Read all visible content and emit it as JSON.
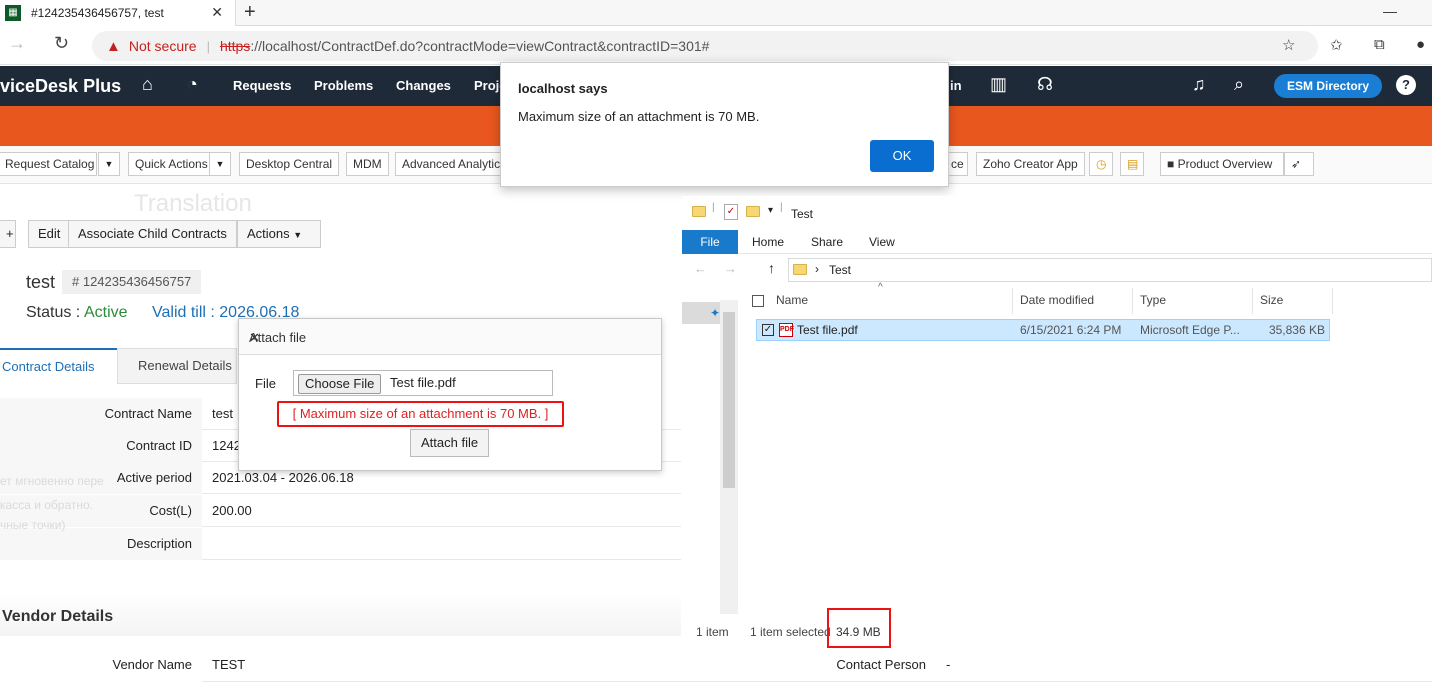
{
  "browser": {
    "tab_title": "#124235436456757, test",
    "tab_close": "✕",
    "new_tab": "+",
    "minimize": "—",
    "not_secure": "Not secure",
    "url_proto": "https",
    "url_rest": "://localhost/ContractDef.do?contractMode=viewContract&contractID=301#"
  },
  "app": {
    "logo": "viceDesk Plus",
    "nav": [
      "Requests",
      "Problems",
      "Changes",
      "Proje",
      "in"
    ],
    "esm": "ESM Directory",
    "help": "?"
  },
  "quickbar": {
    "items": [
      "Request Catalog",
      "Quick Actions",
      "Desktop Central",
      "MDM",
      "Advanced Analytic",
      "ce",
      "Zoho Creator App",
      "Product Overview"
    ],
    "ghost": "Translation"
  },
  "toolbar": {
    "edit": "Edit",
    "associate": "Associate Child Contracts",
    "actions": "Actions"
  },
  "contract": {
    "name": "test",
    "id": "# 124235436456757",
    "status_label": "Status :",
    "status": "Active",
    "valid": "Valid till : 2026.06.18",
    "tabs": [
      "Contract Details",
      "Renewal Details"
    ],
    "rows": [
      {
        "label": "Contract Name",
        "value": "test"
      },
      {
        "label": "Contract ID",
        "value": "1242"
      },
      {
        "label": "Active period",
        "value": "2021.03.04 - 2026.06.18"
      },
      {
        "label": "Cost(L)",
        "value": "200.00"
      },
      {
        "label": "Description",
        "value": ""
      }
    ],
    "ghost": [
      "ет мгновенно пере",
      "касса и обратно.",
      "чные точки)"
    ]
  },
  "vendor": {
    "header": "Vendor Details",
    "name_label": "Vendor Name",
    "name_value": "TEST",
    "contact_label": "Contact Person",
    "contact_value": "-"
  },
  "attach_dialog": {
    "title": "Attach file",
    "close": "✕",
    "file_label": "File",
    "choose": "Choose File",
    "filename": "Test file.pdf",
    "error": "[ Maximum size of an attachment is 70 MB. ]",
    "button": "Attach file"
  },
  "alert": {
    "title": "localhost says",
    "message": "Maximum size of an attachment is 70 MB.",
    "ok": "OK"
  },
  "explorer": {
    "folder": "Test",
    "ribbon": [
      "File",
      "Home",
      "Share",
      "View"
    ],
    "columns": [
      "Name",
      "Date modified",
      "Type",
      "Size"
    ],
    "file": {
      "name": "Test file.pdf",
      "modified": "6/15/2021 6:24 PM",
      "type": "Microsoft Edge P...",
      "size": "35,836 KB"
    },
    "status_items": "1 item",
    "status_selected": "1 item selected",
    "status_size": "34.9 MB"
  },
  "colors": {
    "header": "#1f2a38",
    "orange": "#e8571d",
    "accent": "#1a7fd4",
    "error": "#e11111"
  }
}
